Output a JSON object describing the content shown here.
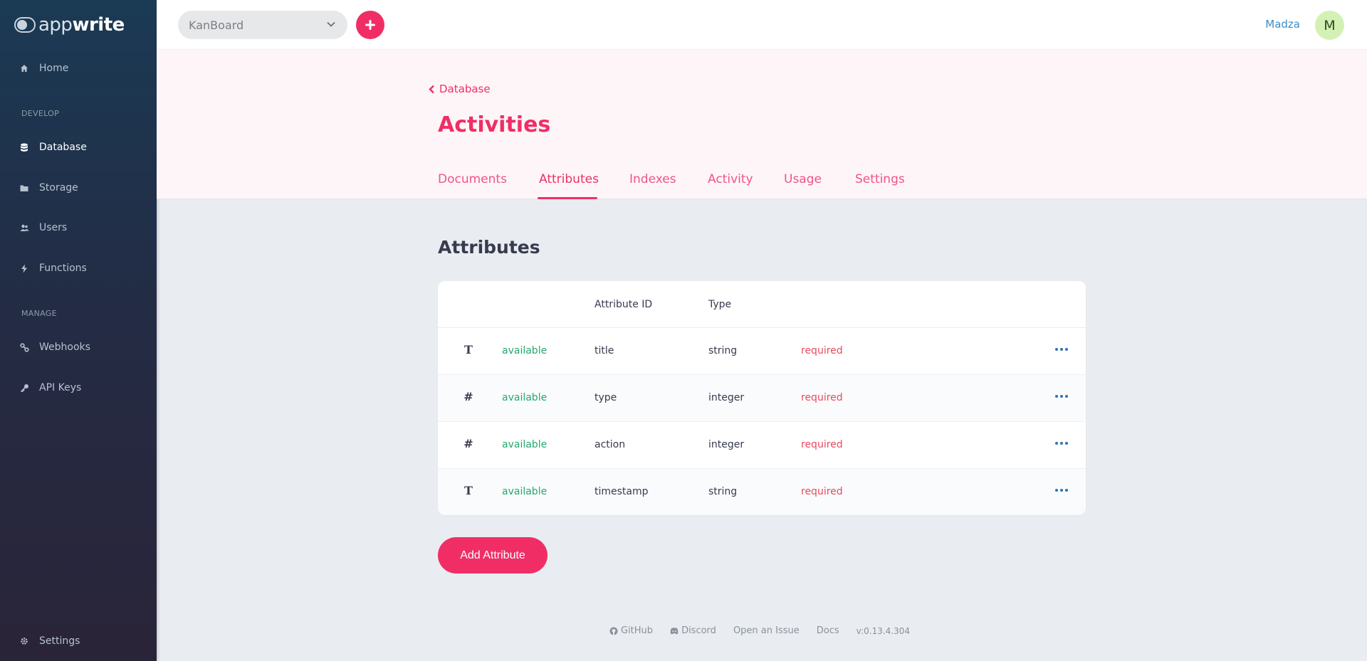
{
  "brand": {
    "name_light": "app",
    "name_bold": "write"
  },
  "sidebar": {
    "items": [
      {
        "label": "Home",
        "icon": "home-icon"
      },
      {
        "label": "Database",
        "icon": "database-icon",
        "active": true
      },
      {
        "label": "Storage",
        "icon": "folder-icon"
      },
      {
        "label": "Users",
        "icon": "users-icon"
      },
      {
        "label": "Functions",
        "icon": "bolt-icon"
      },
      {
        "label": "Webhooks",
        "icon": "link-icon"
      },
      {
        "label": "API Keys",
        "icon": "key-icon"
      },
      {
        "label": "Settings",
        "icon": "gear-icon"
      }
    ],
    "sections": {
      "develop": "DEVELOP",
      "manage": "MANAGE"
    }
  },
  "header": {
    "project": "KanBoard",
    "user_name": "Madza",
    "avatar_initial": "M"
  },
  "cover": {
    "back_label": "Database",
    "title": "Activities",
    "tabs": [
      {
        "label": "Documents"
      },
      {
        "label": "Attributes",
        "active": true
      },
      {
        "label": "Indexes"
      },
      {
        "label": "Activity"
      },
      {
        "label": "Usage"
      },
      {
        "label": "Settings"
      }
    ]
  },
  "main": {
    "section_title": "Attributes",
    "table": {
      "columns": {
        "id": "Attribute ID",
        "type": "Type"
      },
      "rows": [
        {
          "icon": "T",
          "status": "available",
          "id": "title",
          "type": "string",
          "required": "required"
        },
        {
          "icon": "#",
          "status": "available",
          "id": "type",
          "type": "integer",
          "required": "required"
        },
        {
          "icon": "#",
          "status": "available",
          "id": "action",
          "type": "integer",
          "required": "required"
        },
        {
          "icon": "T",
          "status": "available",
          "id": "timestamp",
          "type": "string",
          "required": "required"
        }
      ]
    },
    "add_button": "Add Attribute"
  },
  "footer": {
    "github": "GitHub",
    "discord": "Discord",
    "issue": "Open an Issue",
    "docs": "Docs",
    "version": "v:0.13.4.304"
  },
  "colors": {
    "accent": "#f02e65",
    "success": "#26a96c",
    "link": "#3b8fc4"
  }
}
